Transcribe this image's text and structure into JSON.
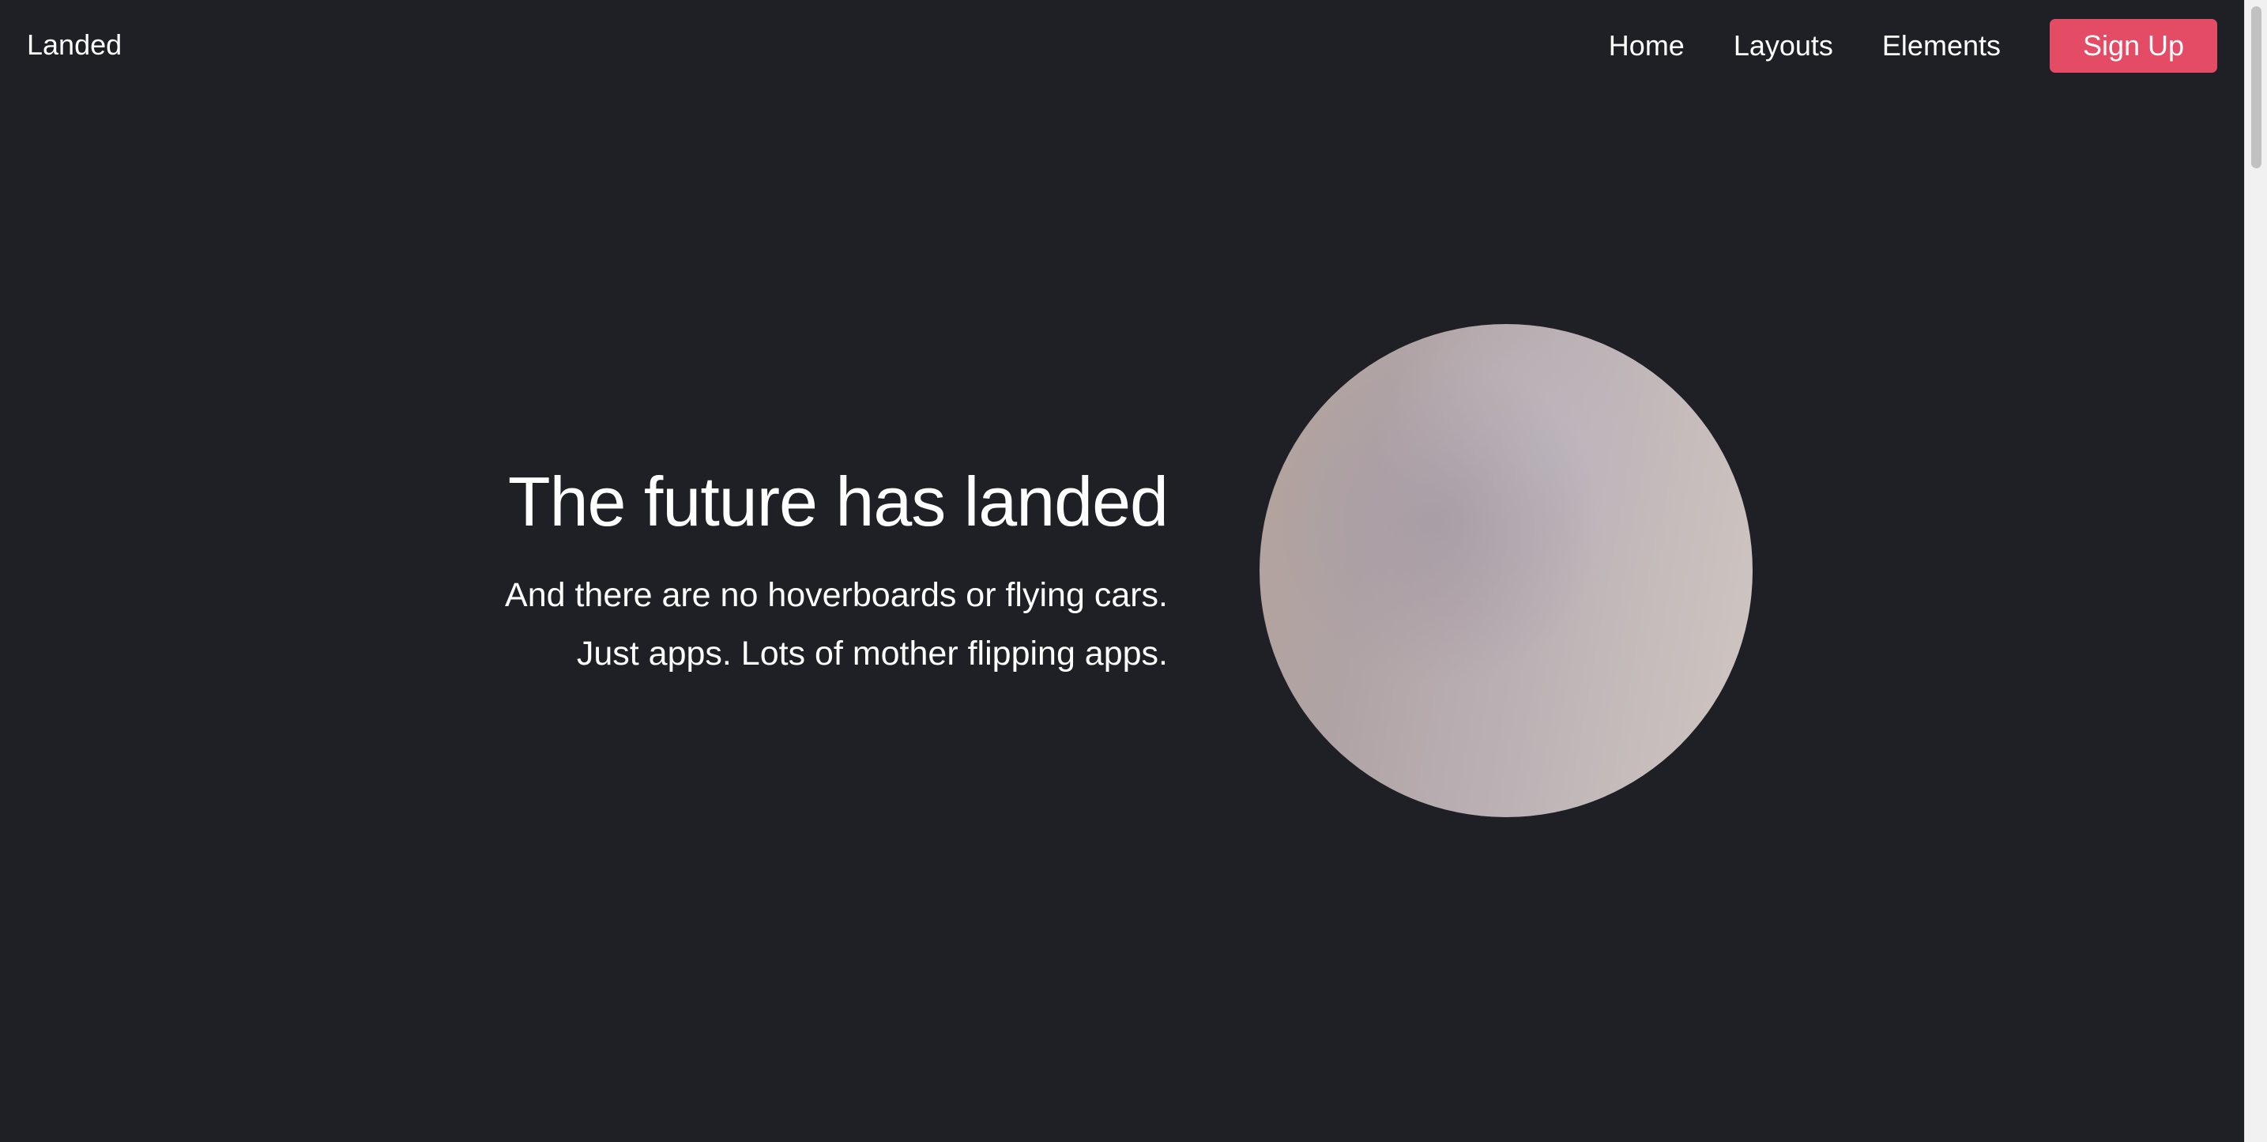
{
  "header": {
    "logo": "Landed",
    "nav": [
      {
        "label": "Home"
      },
      {
        "label": "Layouts"
      },
      {
        "label": "Elements"
      }
    ],
    "signup_label": "Sign Up"
  },
  "hero": {
    "title": "The future has landed",
    "subtitle_line1": "And there are no hoverboards or flying cars.",
    "subtitle_line2": "Just apps. Lots of mother flipping apps.",
    "image_icon": "hero-circle-image"
  },
  "colors": {
    "background": "#1f1f26",
    "accent": "#e44c65",
    "text": "#ffffff"
  }
}
